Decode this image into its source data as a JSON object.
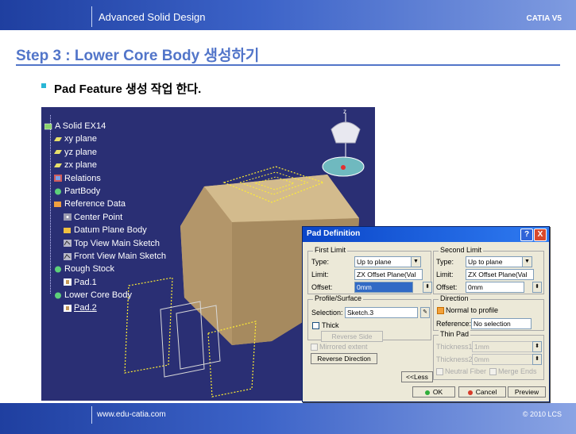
{
  "header": {
    "title": "Advanced Solid Design",
    "brand": "CATIA V5"
  },
  "slide": {
    "heading": "Step 3 : Lower Core Body 생성하기",
    "bullet": "Pad Feature 생성 작업 한다."
  },
  "tree": {
    "items": [
      {
        "label": "A Solid EX14",
        "icon": "part-icon"
      },
      {
        "label": "xy plane",
        "icon": "plane-icon"
      },
      {
        "label": "yz plane",
        "icon": "plane-icon"
      },
      {
        "label": "zx plane",
        "icon": "plane-icon"
      },
      {
        "label": "Relations",
        "icon": "relations-icon"
      },
      {
        "label": "PartBody",
        "icon": "body-icon"
      },
      {
        "label": "Reference Data",
        "icon": "geometric-set-icon"
      },
      {
        "label": "Center Point",
        "icon": "point-icon"
      },
      {
        "label": "Datum Plane Body",
        "icon": "body-icon"
      },
      {
        "label": "Top View Main Sketch",
        "icon": "sketch-icon"
      },
      {
        "label": "Front View Main Sketch",
        "icon": "sketch-icon"
      },
      {
        "label": "Rough Stock",
        "icon": "body-icon"
      },
      {
        "label": "Pad.1",
        "icon": "pad-icon"
      },
      {
        "label": "Lower Core Body",
        "icon": "body-icon"
      },
      {
        "label": "Pad.2",
        "icon": "pad-icon"
      }
    ]
  },
  "dialog": {
    "title": "Pad Definition",
    "help_btn": "?",
    "close_btn": "X",
    "first_limit": {
      "legend": "First Limit",
      "type_label": "Type:",
      "type_value": "Up to plane",
      "limit_label": "Limit:",
      "limit_value": "ZX Offset Plane(Val",
      "offset_label": "Offset:",
      "offset_value": "0mm"
    },
    "profile": {
      "legend": "Profile/Surface",
      "selection_label": "Selection:",
      "selection_value": "Sketch.3",
      "thick_label": "Thick",
      "reverse_side": "Reverse Side"
    },
    "mirrored_label": "Mirrored extent",
    "reverse_direction": "Reverse Direction",
    "second_limit": {
      "legend": "Second Limit",
      "type_label": "Type:",
      "type_value": "Up to plane",
      "limit_label": "Limit:",
      "limit_value": "ZX Offset Plane(Val",
      "offset_label": "Offset:",
      "offset_value": "0mm"
    },
    "direction": {
      "legend": "Direction",
      "normal_label": "Normal to profile",
      "reference_label": "Reference:",
      "reference_value": "No selection"
    },
    "thin_pad": {
      "legend": "Thin Pad",
      "thickness1_label": "Thickness1:",
      "thickness1_value": "1mm",
      "thickness2_label": "Thickness2:",
      "thickness2_value": "0mm",
      "neutral_label": "Neutral Fiber",
      "merge_label": "Merge Ends"
    },
    "less_btn": "<<Less",
    "ok_btn": "OK",
    "cancel_btn": "Cancel",
    "preview_btn": "Preview"
  },
  "footer": {
    "website": "www.edu-catia.com",
    "copyright": "© 2010 LCS"
  }
}
